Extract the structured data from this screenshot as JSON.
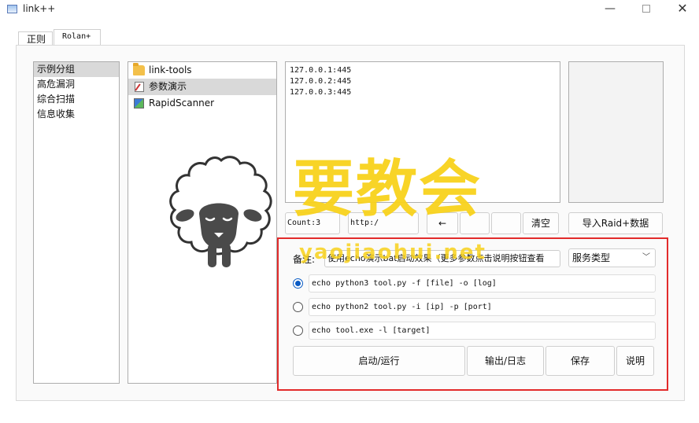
{
  "window": {
    "title": "link++",
    "minimize": "—",
    "close": "✕"
  },
  "tabs": [
    {
      "label": "正则"
    },
    {
      "label": "Rolan+"
    }
  ],
  "groups": [
    "示例分组",
    "高危漏洞",
    "综合扫描",
    "信息收集"
  ],
  "tools": [
    {
      "label": "link-tools",
      "icon": "folder-icon"
    },
    {
      "label": "参数演示",
      "icon": "document-icon"
    },
    {
      "label": "RapidScanner",
      "icon": "app-icon"
    }
  ],
  "targets_text": "127.0.0.1:445\n127.0.0.2:445\n127.0.0.3:445",
  "toolbar": {
    "count_label": "Count:3",
    "http_label": "http:/",
    "arrow_label": "←",
    "btn4_label": "",
    "btn5_label": "",
    "clear_label": "清空",
    "import_label": "导入Raid+数据"
  },
  "remark": {
    "label": "备注:",
    "value": "使用echo演示bat启动效果（更多参数点击说明按钮查看"
  },
  "service_select": {
    "value": "服务类型"
  },
  "commands": [
    {
      "text": "echo python3 tool.py -f [file] -o [log]",
      "selected": true
    },
    {
      "text": "echo python2 tool.py -i [ip] -p [port]",
      "selected": false
    },
    {
      "text": "echo tool.exe -l [target]",
      "selected": false
    }
  ],
  "actions": {
    "run_label": "启动/运行",
    "output_label": "输出/日志",
    "save_label": "保存",
    "help_label": "说明"
  },
  "watermark": {
    "main": "要教会",
    "url": "yaojiaohui.net"
  },
  "colors": {
    "accent": "#0a5bc4",
    "highlight_border": "#e22b2b",
    "watermark": "#f8d21c"
  }
}
